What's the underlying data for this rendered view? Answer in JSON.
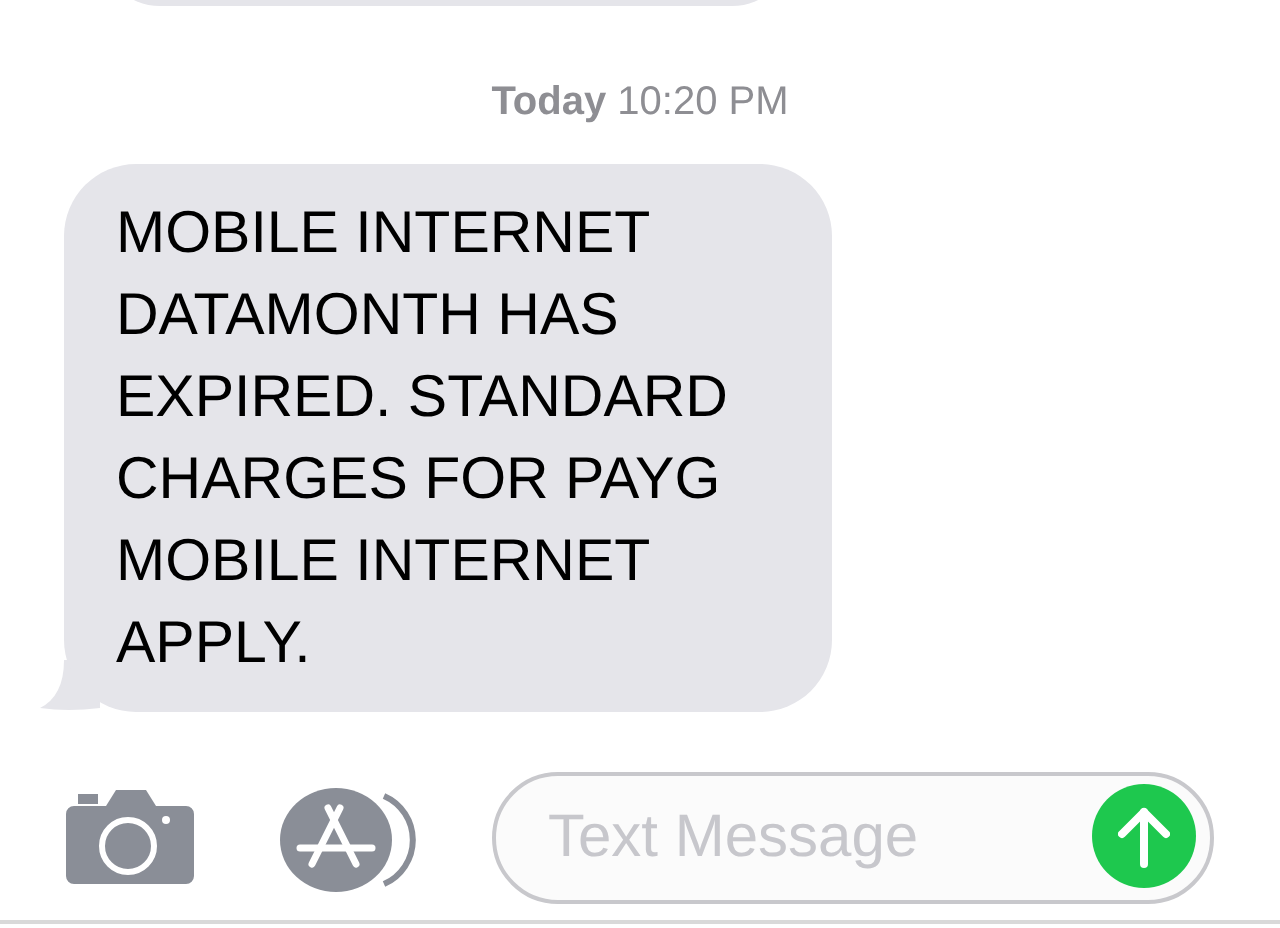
{
  "timestamp": "**Today** 10:20 PM",
  "messages": [
    {
      "text": "MOBILE INTERNET DATAMONTH HAS EXPIRED. STANDARD CHARGES FOR PAYG MOBILE INTERNET APPLY.",
      "kind": "incoming"
    }
  ],
  "composer": {
    "placeholder": "Text Message"
  }
}
